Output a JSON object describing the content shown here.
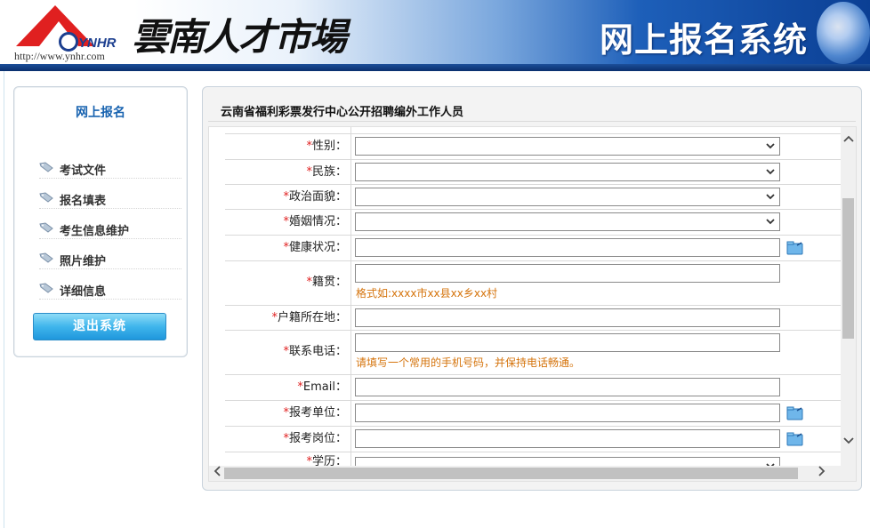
{
  "header": {
    "logo_text": "YNHR",
    "logo_url": "http://www.ynhr.com",
    "calligraphy": "雲南人才市場",
    "system_title": "网上报名系统"
  },
  "sidebar": {
    "title": "网上报名",
    "items": [
      {
        "label": "考试文件"
      },
      {
        "label": "报名填表"
      },
      {
        "label": "考生信息维护"
      },
      {
        "label": "照片维护"
      },
      {
        "label": "详细信息"
      }
    ],
    "logout_label": "退出系统"
  },
  "main": {
    "title": "云南省福利彩票发行中心公开招聘编外工作人员",
    "required_mark": "*",
    "fields": [
      {
        "label": "性别：",
        "type": "select",
        "value": ""
      },
      {
        "label": "民族：",
        "type": "select",
        "value": ""
      },
      {
        "label": "政治面貌：",
        "type": "select",
        "value": ""
      },
      {
        "label": "婚姻情况：",
        "type": "select",
        "value": ""
      },
      {
        "label": "健康状况：",
        "type": "input-pick",
        "value": ""
      },
      {
        "label": "籍贯：",
        "type": "input-hint",
        "value": "",
        "hint": "格式如:xxxx市xx县xx乡xx村"
      },
      {
        "label": "户籍所在地：",
        "type": "input",
        "value": ""
      },
      {
        "label": "联系电话：",
        "type": "input-hint",
        "value": "",
        "hint": "请填写一个常用的手机号码，并保持电话畅通。"
      },
      {
        "label": "Email：",
        "type": "input",
        "value": ""
      },
      {
        "label": "报考单位：",
        "type": "input-pick",
        "value": ""
      },
      {
        "label": "报考岗位：",
        "type": "input-pick",
        "value": ""
      },
      {
        "label": "学历：",
        "type": "select",
        "value": ""
      }
    ]
  },
  "colors": {
    "accent_blue": "#1863b0",
    "required_red": "#e02020",
    "hint_orange": "#d5740d"
  }
}
